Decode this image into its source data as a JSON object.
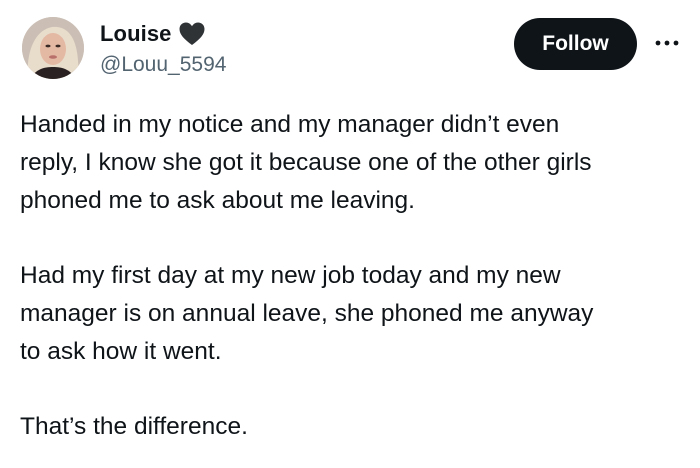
{
  "author": {
    "display_name": "Louise",
    "badge_icon": "black-heart-icon",
    "handle": "@Louu_5594"
  },
  "actions": {
    "follow_label": "Follow",
    "more_icon": "more-horizontal-icon"
  },
  "tweet": {
    "paragraphs": [
      {
        "lines": [
          "Handed in my notice and my manager didn’t even",
          "reply, I know she got it because one of the other girls",
          "phoned me to ask about me leaving."
        ]
      },
      {
        "lines": [
          "Had my first day at my new job today and my new",
          "manager is on annual leave, she phoned me anyway",
          "to ask how it went."
        ]
      },
      {
        "lines": [
          "That’s the difference."
        ]
      }
    ]
  },
  "colors": {
    "text": "#0f1419",
    "secondary_text": "#536471",
    "follow_bg": "#0f1419",
    "follow_text": "#ffffff",
    "background": "#ffffff"
  }
}
